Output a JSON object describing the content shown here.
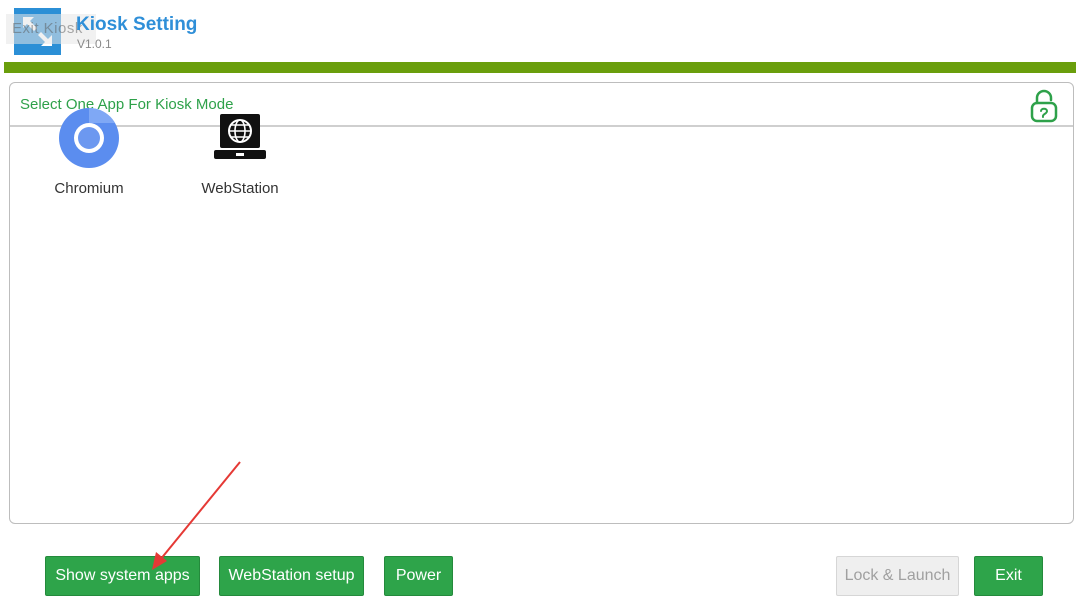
{
  "header": {
    "title": "Kiosk Setting",
    "version": "V1.0.1",
    "faded_overlay_text": "Exit Kiosk",
    "icon": "expand-arrows-icon"
  },
  "colors": {
    "brand_blue": "#2f8fd8",
    "accent_green": "#2ea44a",
    "bar_green": "#6a9e0c",
    "annotation_red": "#e53935"
  },
  "panel": {
    "title": "Select One App For Kiosk Mode",
    "lock_icon": "unlock-icon",
    "apps": [
      {
        "label": "Chromium",
        "icon": "chromium-icon"
      },
      {
        "label": "WebStation",
        "icon": "webstation-globe-icon"
      }
    ]
  },
  "footer": {
    "show_system_apps": "Show system apps",
    "webstation_setup": "WebStation setup",
    "power": "Power",
    "lock_launch": "Lock & Launch",
    "exit": "Exit"
  }
}
